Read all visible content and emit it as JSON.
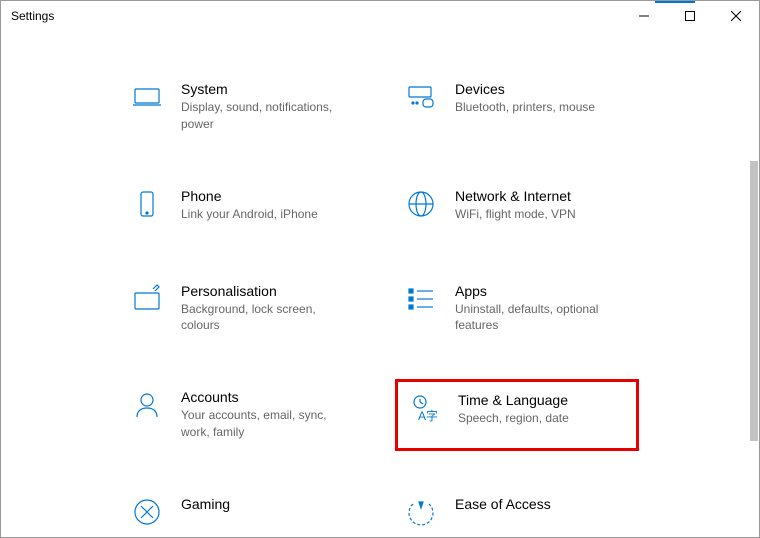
{
  "window": {
    "title": "Settings"
  },
  "categories": [
    {
      "id": "system",
      "title": "System",
      "desc": "Display, sound, notifications, power"
    },
    {
      "id": "devices",
      "title": "Devices",
      "desc": "Bluetooth, printers, mouse"
    },
    {
      "id": "phone",
      "title": "Phone",
      "desc": "Link your Android, iPhone"
    },
    {
      "id": "network",
      "title": "Network & Internet",
      "desc": "WiFi, flight mode, VPN"
    },
    {
      "id": "personalisation",
      "title": "Personalisation",
      "desc": "Background, lock screen, colours"
    },
    {
      "id": "apps",
      "title": "Apps",
      "desc": "Uninstall, defaults, optional features"
    },
    {
      "id": "accounts",
      "title": "Accounts",
      "desc": "Your accounts, email, sync, work, family"
    },
    {
      "id": "time-language",
      "title": "Time & Language",
      "desc": "Speech, region, date",
      "highlight": true
    },
    {
      "id": "gaming",
      "title": "Gaming",
      "desc": ""
    },
    {
      "id": "ease-of-access",
      "title": "Ease of Access",
      "desc": ""
    }
  ]
}
